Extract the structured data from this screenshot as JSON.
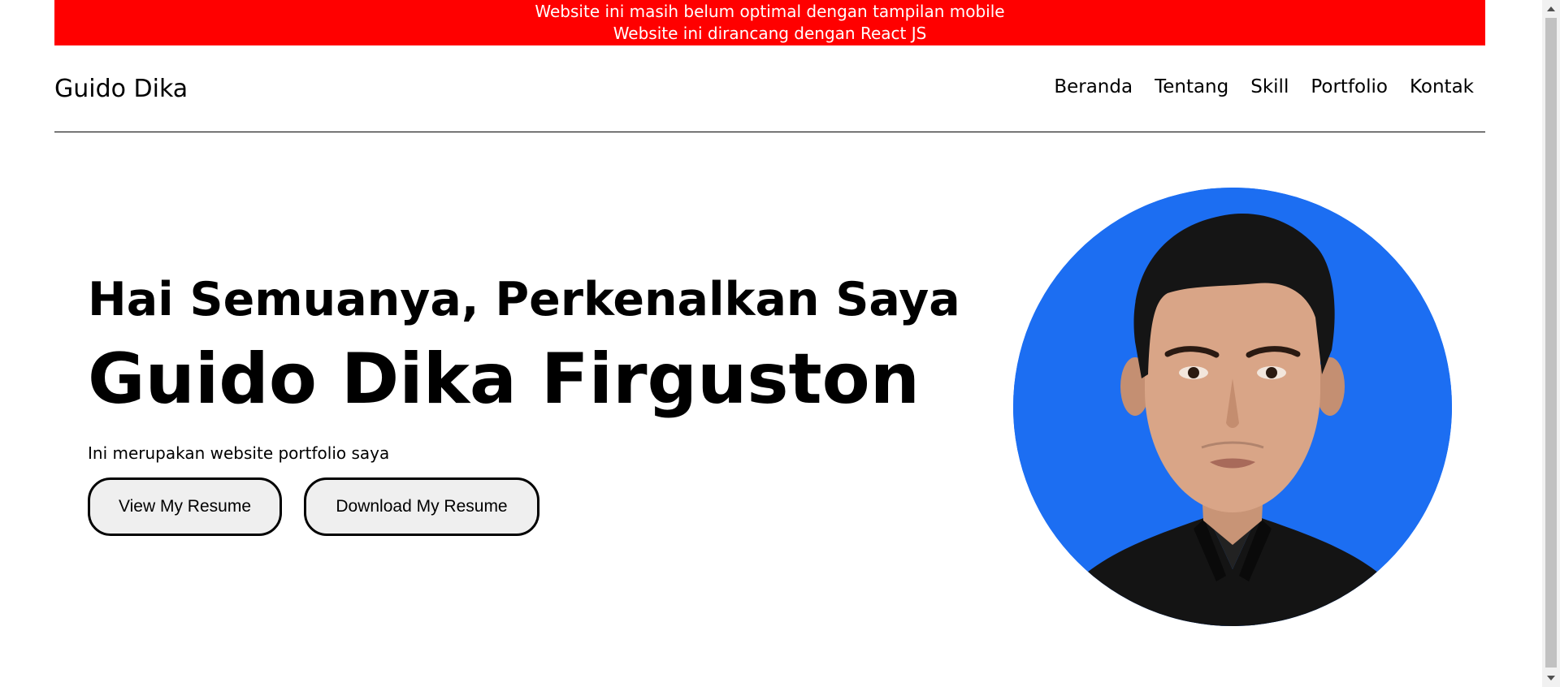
{
  "notice": {
    "line1": "Website ini masih belum optimal dengan tampilan mobile",
    "line2": "Website ini dirancang dengan React JS",
    "background_color": "#ff0000"
  },
  "navbar": {
    "brand": "Guido Dika",
    "links": [
      {
        "label": "Beranda"
      },
      {
        "label": "Tentang"
      },
      {
        "label": "Skill"
      },
      {
        "label": "Portfolio"
      },
      {
        "label": "Kontak"
      }
    ]
  },
  "hero": {
    "greeting": "Hai Semuanya, Perkenalkan Saya",
    "name": "Guido Dika Firguston",
    "tagline": "Ini merupakan website portfolio saya",
    "view_resume_label": "View My Resume",
    "download_resume_label": "Download My Resume",
    "avatar_background": "#1c6ef2"
  }
}
